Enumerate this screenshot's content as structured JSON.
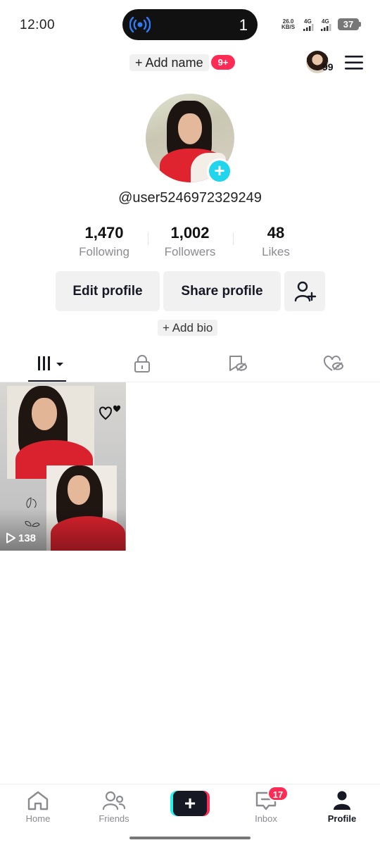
{
  "status_bar": {
    "time": "12:00",
    "island_count": "1",
    "net_speed_top": "26.0",
    "net_speed_bottom": "KB/S",
    "signal1_label": "4G",
    "signal2_label": "4G",
    "battery": "37"
  },
  "top_bar": {
    "add_name_label": "+ Add name",
    "add_name_badge": "9+",
    "avatar_count": "99"
  },
  "profile": {
    "username": "@user5246972329249",
    "stats": [
      {
        "value": "1,470",
        "label": "Following"
      },
      {
        "value": "1,002",
        "label": "Followers"
      },
      {
        "value": "48",
        "label": "Likes"
      }
    ],
    "edit_profile_label": "Edit profile",
    "share_profile_label": "Share profile",
    "add_bio_label": "+ Add bio"
  },
  "tabs": [
    {
      "icon": "videos-grid-icon",
      "active": true
    },
    {
      "icon": "lock-icon",
      "active": false
    },
    {
      "icon": "favorites-hidden-icon",
      "active": false
    },
    {
      "icon": "liked-hidden-icon",
      "active": false
    }
  ],
  "videos": [
    {
      "views": "138"
    }
  ],
  "bottom_nav": [
    {
      "label": "Home",
      "icon": "home-icon"
    },
    {
      "label": "Friends",
      "icon": "friends-icon"
    },
    {
      "label": "",
      "icon": "plus-icon"
    },
    {
      "label": "Inbox",
      "icon": "inbox-icon",
      "badge": "17"
    },
    {
      "label": "Profile",
      "icon": "profile-icon",
      "active": true
    }
  ],
  "colors": {
    "accent_red": "#fe2c55",
    "accent_cyan": "#20d5ec",
    "text_primary": "#161823",
    "text_secondary": "#8a8b91",
    "button_bg": "#f1f1f2"
  }
}
